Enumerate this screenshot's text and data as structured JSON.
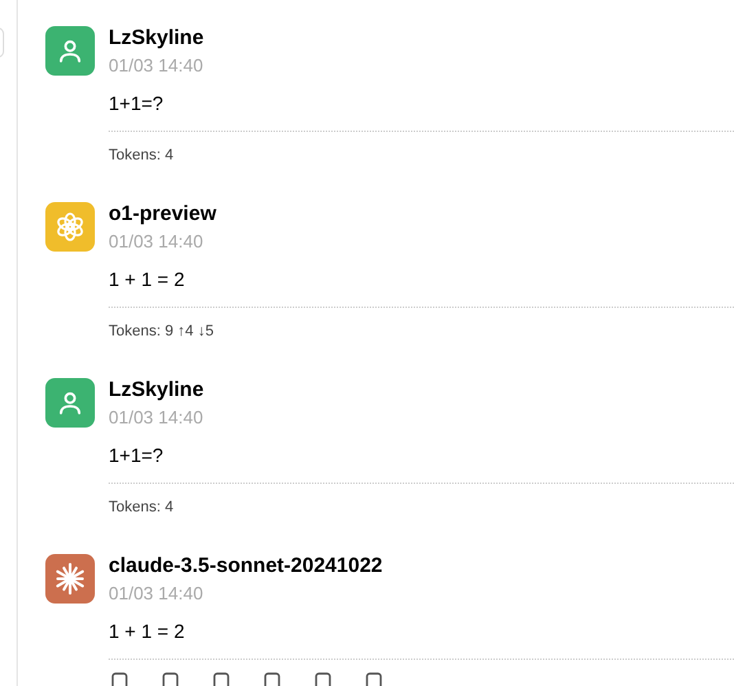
{
  "messages": [
    {
      "kind": "user",
      "sender": "LzSkyline",
      "time": "01/03 14:40",
      "content": "1+1=?",
      "tokens": "Tokens: 4"
    },
    {
      "kind": "openai",
      "sender": "o1-preview",
      "time": "01/03 14:40",
      "content": "1 + 1 = 2",
      "tokens": "Tokens: 9 ↑4 ↓5"
    },
    {
      "kind": "user",
      "sender": "LzSkyline",
      "time": "01/03 14:40",
      "content": "1+1=?",
      "tokens": "Tokens: 4"
    },
    {
      "kind": "claude",
      "sender": "claude-3.5-sonnet-20241022",
      "time": "01/03 14:40",
      "content": "1 + 1 = 2",
      "toolbar": true
    }
  ]
}
